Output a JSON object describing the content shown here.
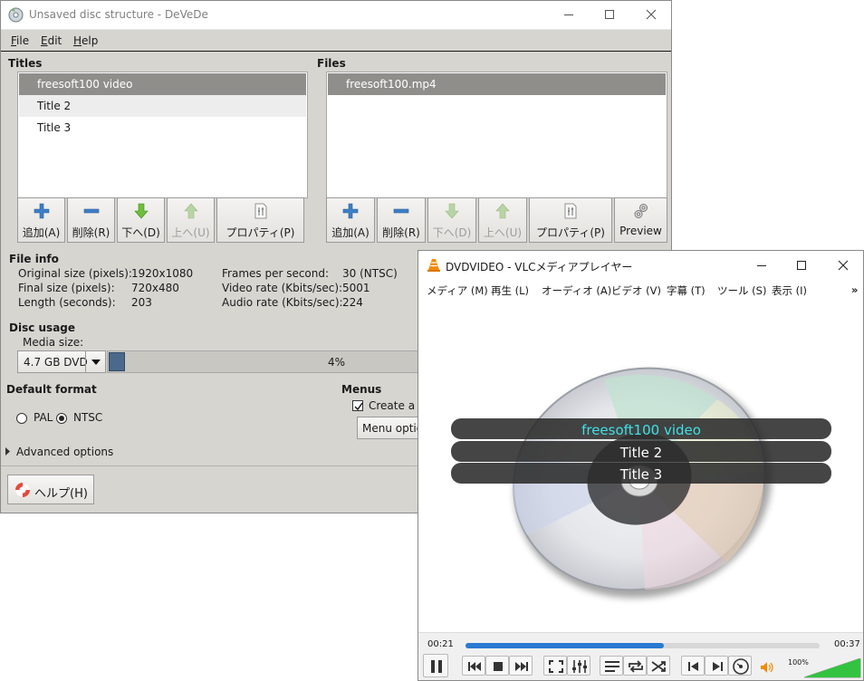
{
  "devede": {
    "window_title": "Unsaved disc structure - DeVeDe",
    "menu": [
      {
        "label": "File",
        "key": "F"
      },
      {
        "label": "Edit",
        "key": "E"
      },
      {
        "label": "Help",
        "key": "H"
      }
    ],
    "titles_label": "Titles",
    "files_label": "Files",
    "titles": [
      "freesoft100 video",
      "Title 2",
      "Title 3"
    ],
    "files": [
      "freesoft100.mp4"
    ],
    "titles_toolbar": [
      {
        "label": "追加(A)",
        "icon": "plus-icon",
        "enabled": true
      },
      {
        "label": "削除(R)",
        "icon": "minus-icon",
        "enabled": true
      },
      {
        "label": "下へ(D)",
        "icon": "arrow-down-icon",
        "enabled": true
      },
      {
        "label": "上へ(U)",
        "icon": "arrow-up-icon",
        "enabled": false
      },
      {
        "label": "プロパティ(P)",
        "icon": "properties-icon",
        "enabled": true
      }
    ],
    "files_toolbar": [
      {
        "label": "追加(A)",
        "icon": "plus-icon",
        "enabled": true
      },
      {
        "label": "削除(R)",
        "icon": "minus-icon",
        "enabled": true
      },
      {
        "label": "下へ(D)",
        "icon": "arrow-down-icon",
        "enabled": false
      },
      {
        "label": "上へ(U)",
        "icon": "arrow-up-icon",
        "enabled": false
      },
      {
        "label": "プロパティ(P)",
        "icon": "properties-icon",
        "enabled": true
      },
      {
        "label": "Preview",
        "icon": "preview-gears-icon",
        "enabled": true
      }
    ],
    "file_info": {
      "heading": "File info",
      "original_size_label": "Original size (pixels):",
      "original_size": "1920x1080",
      "final_size_label": "Final size (pixels):",
      "final_size": "720x480",
      "length_label": "Length (seconds):",
      "length": "203",
      "fps_label": "Frames per second:",
      "fps": "30 (NTSC)",
      "video_rate_label": "Video rate (Kbits/sec):",
      "video_rate": "5001",
      "audio_rate_label": "Audio rate (Kbits/sec):",
      "audio_rate": "224"
    },
    "disc_usage": {
      "heading": "Disc usage",
      "media_size_label": "Media size:",
      "media_size": "4.7 GB DVD",
      "usage_percent": 4,
      "usage_text": "4%"
    },
    "default_format": {
      "heading": "Default format",
      "options": [
        "PAL",
        "NTSC"
      ],
      "selected": "NTSC"
    },
    "menus": {
      "heading": "Menus",
      "create_label": "Create a m",
      "create_checked": true,
      "options_button": "Menu optio"
    },
    "advanced_options": "Advanced options",
    "help_button": "ヘルプ(H)",
    "colors": {
      "window_bg": "#d7d5d0",
      "selection": "#8f8e8b",
      "progress": "#4b6a8b"
    }
  },
  "vlc": {
    "window_title": "DVDVIDEO - VLCメディアプレイヤー",
    "menu": [
      "メディア (M)",
      "再生 (L)",
      "オーディオ (A)",
      "ビデオ (V)",
      "字幕 (T)",
      "ツール (S)",
      "表示 (I)"
    ],
    "menu_overflow": "»",
    "dvd_menu_items": [
      "freesoft100 video",
      "Title 2",
      "Title 3"
    ],
    "highlight_color": "#3fe0e6",
    "time_elapsed": "00:21",
    "time_total": "00:37",
    "seek_fraction": 0.56,
    "volume_label": "100%",
    "volume_fraction": 1.0,
    "accent": "#2a7ad1"
  }
}
